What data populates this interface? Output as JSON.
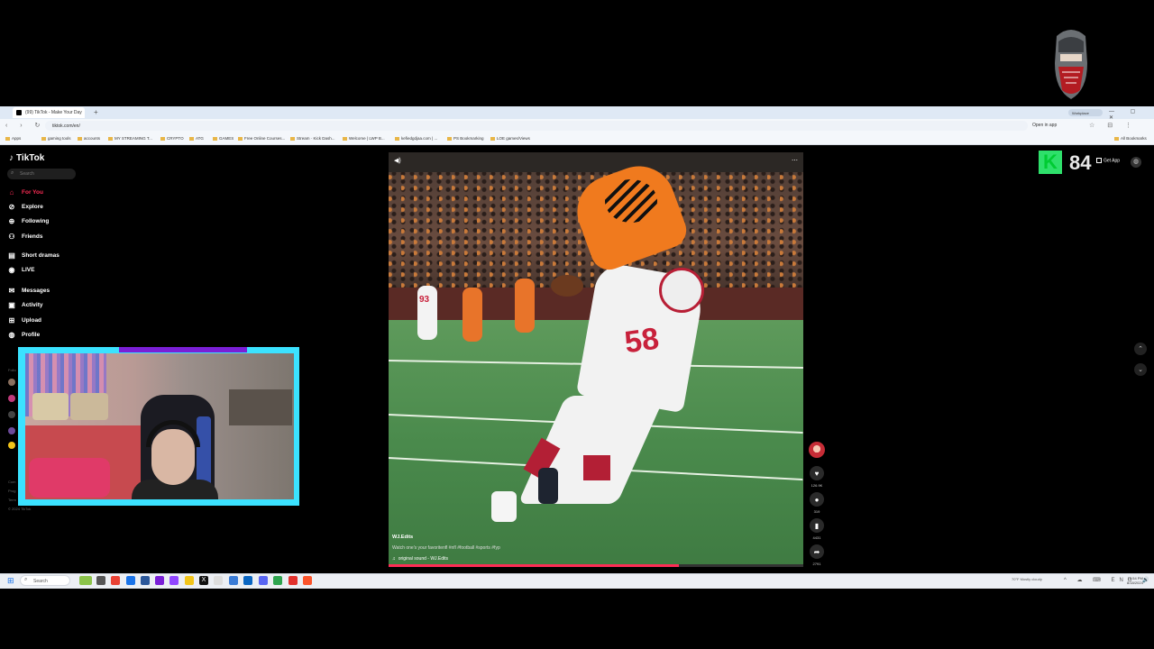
{
  "browser": {
    "tab_title": "(99) TikTok - Make Your Day",
    "new_tab": "+",
    "url": "tiktok.com/en/",
    "profile_chip": "Workplace",
    "open_in_app": "Open in app",
    "window_controls": "— ▢ ✕",
    "nav_buttons": "‹ › ↻",
    "addr_icons": "☆ ⊟ ⋮",
    "bookmarks": [
      "Apps",
      "gaming tools",
      "accounts",
      "MY STREAMING T...",
      "CRYPTO",
      "ATG",
      "GAMES",
      "Free Online Courses...",
      "Stream · Kick Dash...",
      "Welcome | LWP B...",
      "kefiedgdjaa.com | ...",
      "PS Bookmarking",
      "LOE games/Views",
      "All Bookmarks"
    ]
  },
  "tiktok": {
    "logo": "TikTok",
    "search_placeholder": "Search",
    "nav": [
      {
        "label": "For You",
        "icon": "home-icon"
      },
      {
        "label": "Explore",
        "icon": "compass-icon"
      },
      {
        "label": "Following",
        "icon": "following-icon"
      },
      {
        "label": "Friends",
        "icon": "friends-icon"
      },
      {
        "label": "Short dramas",
        "icon": "drama-icon"
      },
      {
        "label": "LIVE",
        "icon": "live-icon"
      },
      {
        "label": "Messages",
        "icon": "messages-icon"
      },
      {
        "label": "Activity",
        "icon": "activity-icon"
      },
      {
        "label": "Upload",
        "icon": "upload-icon"
      },
      {
        "label": "Profile",
        "icon": "profile-icon"
      }
    ],
    "following_heading": "Follo",
    "footer": [
      "Com",
      "Prog",
      "Term",
      "© 2024 TikTok"
    ],
    "get_app": "Get App",
    "video": {
      "author": "WJ.Edits",
      "caption": "Watch one's your favoritenfl #nfl #football #sports #fyp",
      "sound": "original sound - WJ.Edits",
      "progress": 0.7
    },
    "actions": {
      "likes": "126.9K",
      "comments": "319",
      "saves": "4431",
      "shares": "2791"
    }
  },
  "overlay": {
    "points_letter": "K",
    "points_value": "84"
  },
  "taskbar": {
    "search": "Search",
    "weather": "70°F Mostly cloudy",
    "time": "10:54 PM",
    "date": "8/18/2024",
    "tray": "^ ☁ ⌨ ENG 🔊"
  },
  "colors": {
    "accent": "#fe2c55",
    "webcam_border": "#3be2ff",
    "webcam_bar": "#7a1fd6",
    "kick_green": "#2ee06b"
  }
}
